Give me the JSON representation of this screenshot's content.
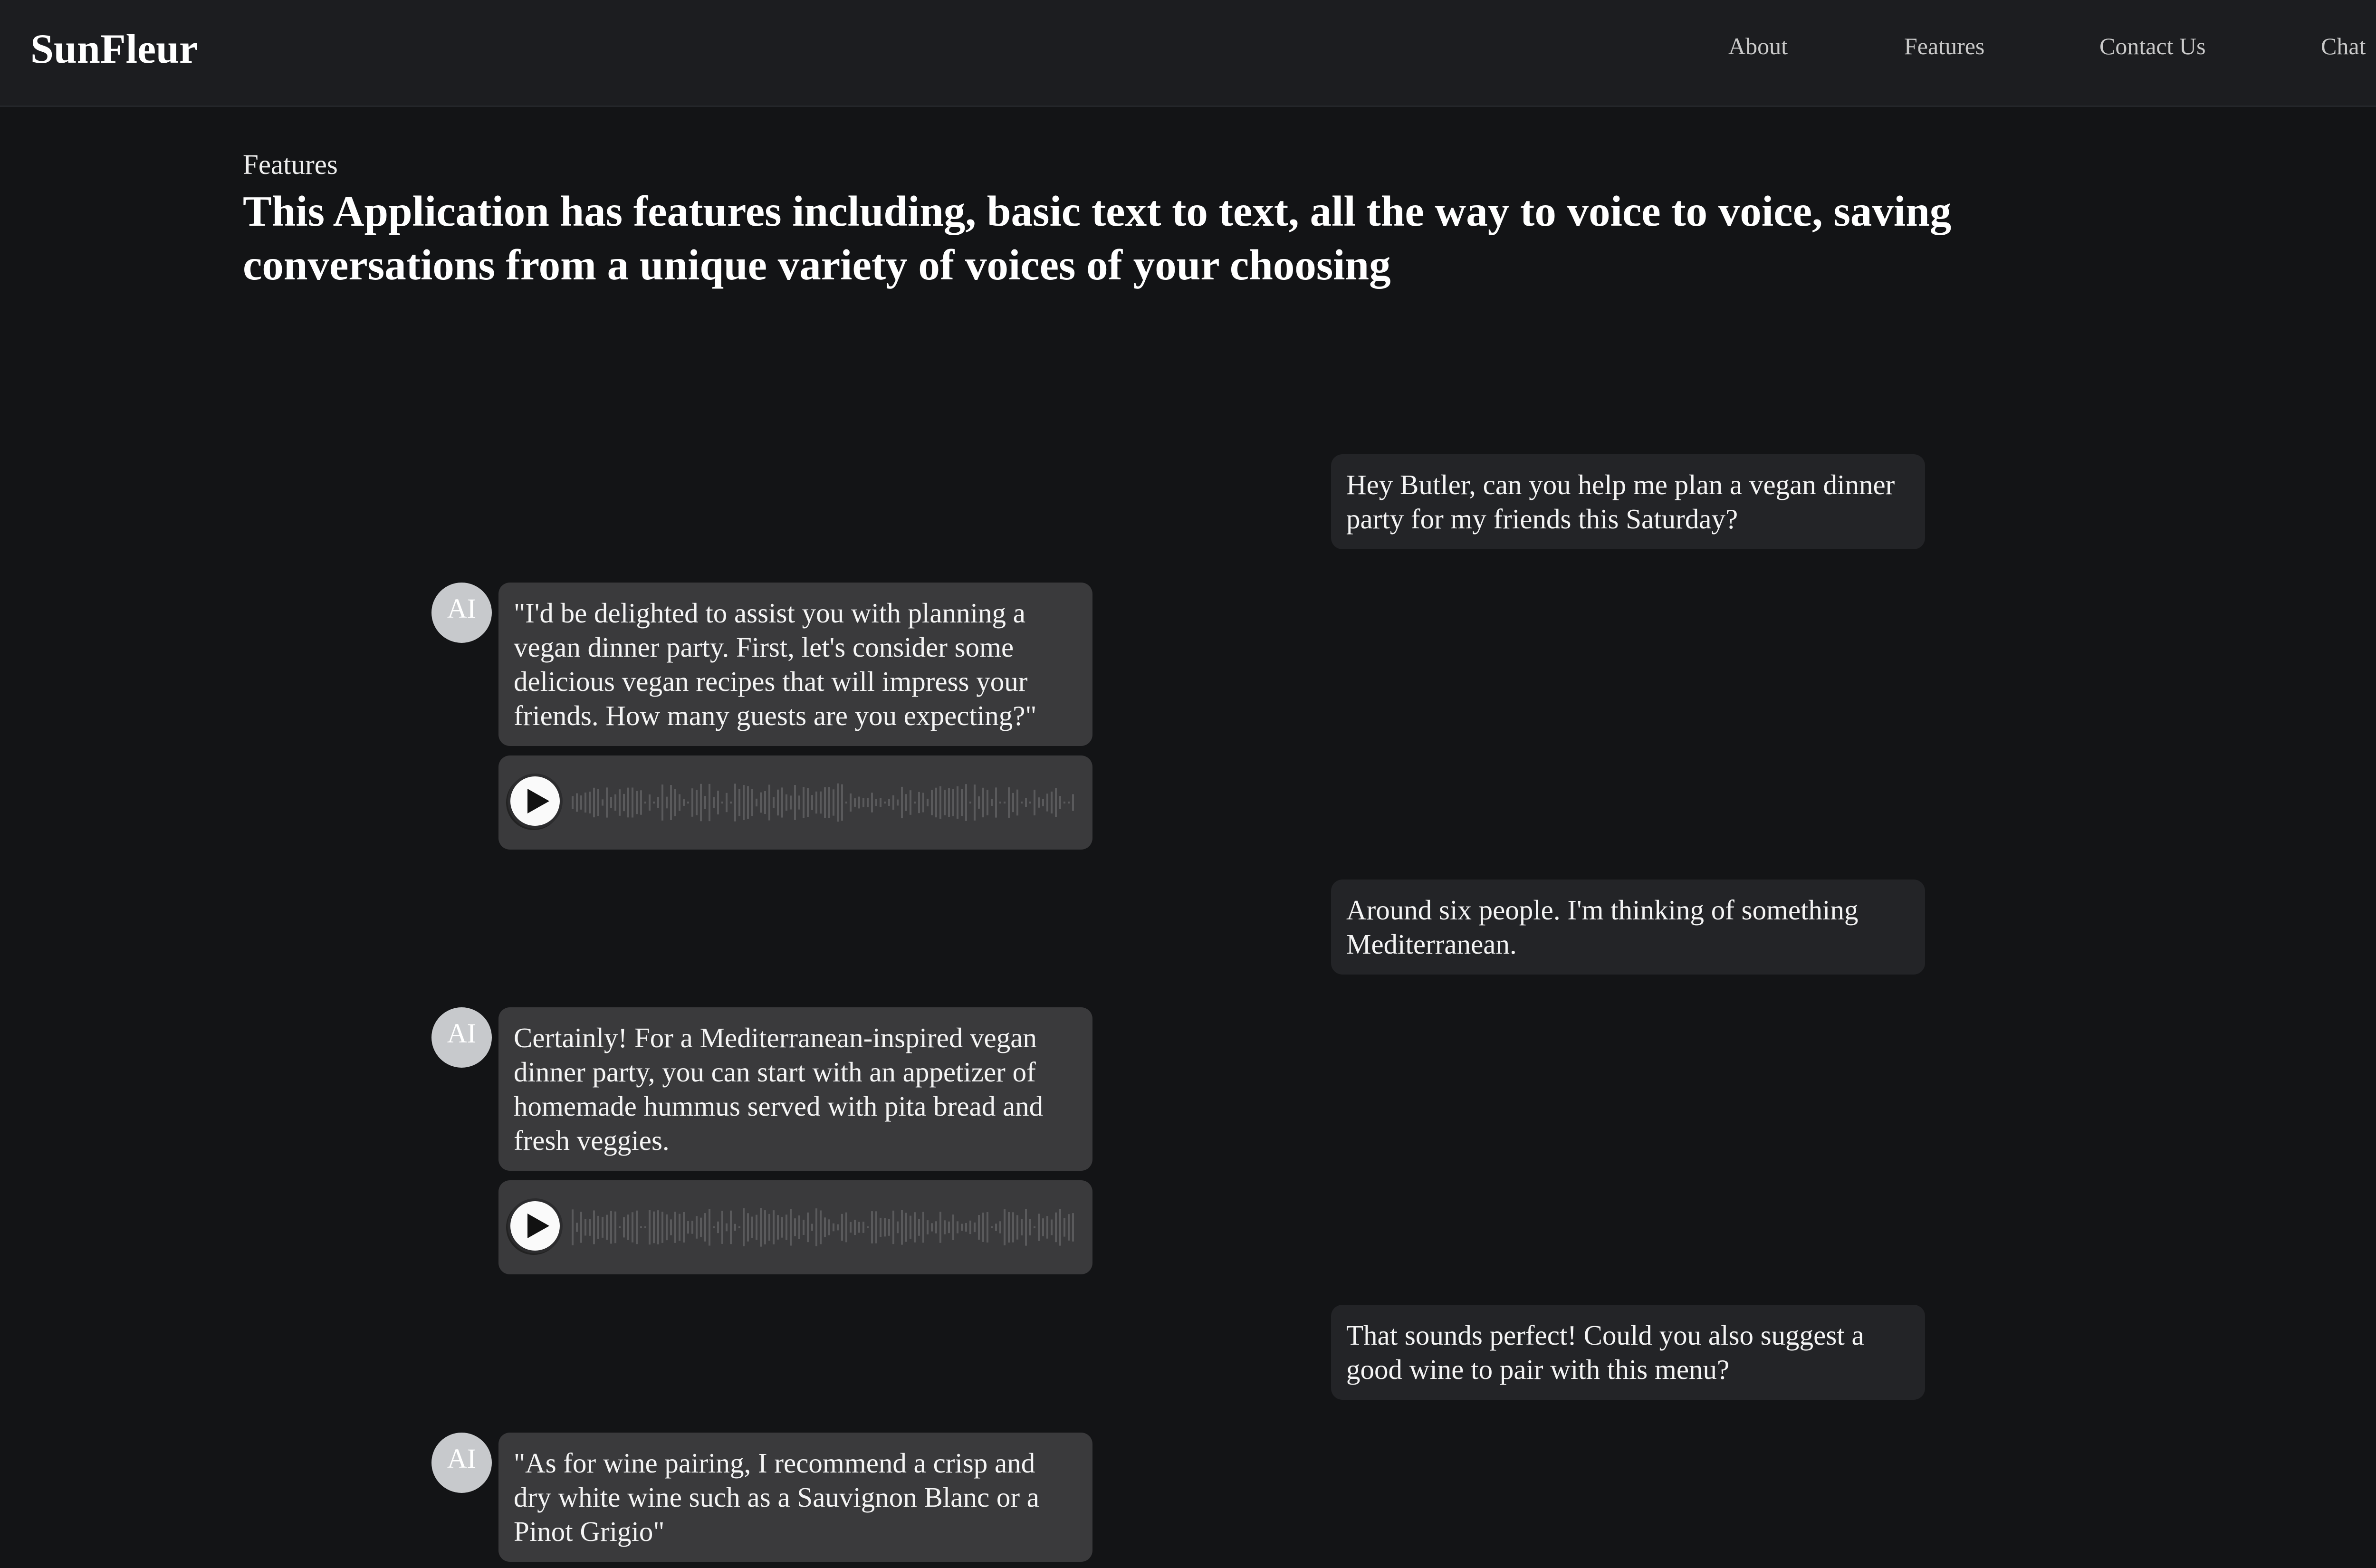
{
  "brand": "SunFleur",
  "nav": [
    "About",
    "Features",
    "Contact Us",
    "Chat"
  ],
  "section_label": "Features",
  "headline": "This Application has features including, basic text to text, all the way to voice to voice, saving conversations from a unique variety of voices of your choosing",
  "avatar_label": "AI",
  "icons": {
    "play": "play-icon",
    "waveform": "waveform-icon"
  },
  "colors": {
    "background": "#131416",
    "topbar": "#1c1d20",
    "user_bubble": "#232427",
    "ai_bubble": "#3a3a3c",
    "avatar": "#c7c9cc"
  },
  "messages": [
    {
      "role": "user",
      "text": "Hey Butler, can you help me plan a vegan dinner party for my friends this Saturday?"
    },
    {
      "role": "ai",
      "text": "\"I'd be delighted to assist you with planning a vegan dinner party. First, let's consider some delicious vegan recipes that will impress your friends. How many guests are you expecting?\"",
      "has_audio": true
    },
    {
      "role": "user",
      "text": "Around six people. I'm thinking of something Mediterranean."
    },
    {
      "role": "ai",
      "text": "Certainly! For a Mediterranean-inspired vegan dinner party, you can start with an appetizer of homemade hummus served with pita bread and fresh veggies.",
      "has_audio": true
    },
    {
      "role": "user",
      "text": "That sounds perfect! Could you also suggest a good wine to pair with this menu?"
    },
    {
      "role": "ai",
      "text": "\"As for wine pairing, I recommend a crisp and dry white wine such as a Sauvignon Blanc or a Pinot Grigio\"",
      "has_audio": false
    }
  ]
}
